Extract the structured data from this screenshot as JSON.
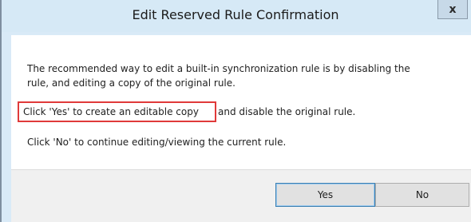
{
  "window": {
    "title": "Edit Reserved Rule Confirmation",
    "close_symbol": "x"
  },
  "message": {
    "line1": "The recommended way to edit a built-in synchronization rule is by disabling the",
    "line2": "rule, and editing a copy of the original rule.",
    "line3_highlighted": "Click 'Yes' to create an editable copy",
    "line3_rest": "and disable the original rule.",
    "line4": "Click 'No' to continue editing/viewing the current rule."
  },
  "buttons": {
    "yes_label": "Yes",
    "no_label": "No"
  },
  "colors": {
    "highlight_border": "#e03a3a",
    "titlebar": "#d6e9f6",
    "default_button_border": "#3c7fb1"
  }
}
